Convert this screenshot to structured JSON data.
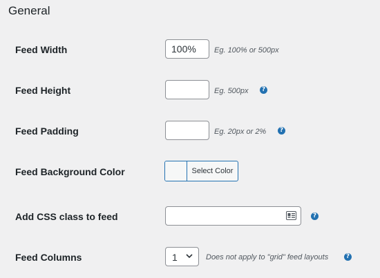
{
  "section": {
    "title": "General"
  },
  "fields": {
    "feed_width": {
      "label": "Feed Width",
      "value": "100%",
      "hint": "Eg. 100% or 500px"
    },
    "feed_height": {
      "label": "Feed Height",
      "value": "",
      "hint": "Eg. 500px",
      "help_icon": "help-icon"
    },
    "feed_padding": {
      "label": "Feed Padding",
      "value": "",
      "hint": "Eg. 20px or 2%",
      "help_icon": "help-icon"
    },
    "feed_background_color": {
      "label": "Feed Background Color",
      "button_label": "Select Color"
    },
    "css_class": {
      "label": "Add CSS class to feed",
      "value": "",
      "icon": "contact-card-icon",
      "help_icon": "help-icon"
    },
    "feed_columns": {
      "label": "Feed Columns",
      "selected": "1",
      "hint": "Does not apply to \"grid\" feed layouts",
      "help_icon": "help-icon"
    }
  },
  "help_glyph": "?",
  "colors": {
    "accent": "#2271b1",
    "background": "#f0f0f1",
    "border": "#8c8f94"
  }
}
